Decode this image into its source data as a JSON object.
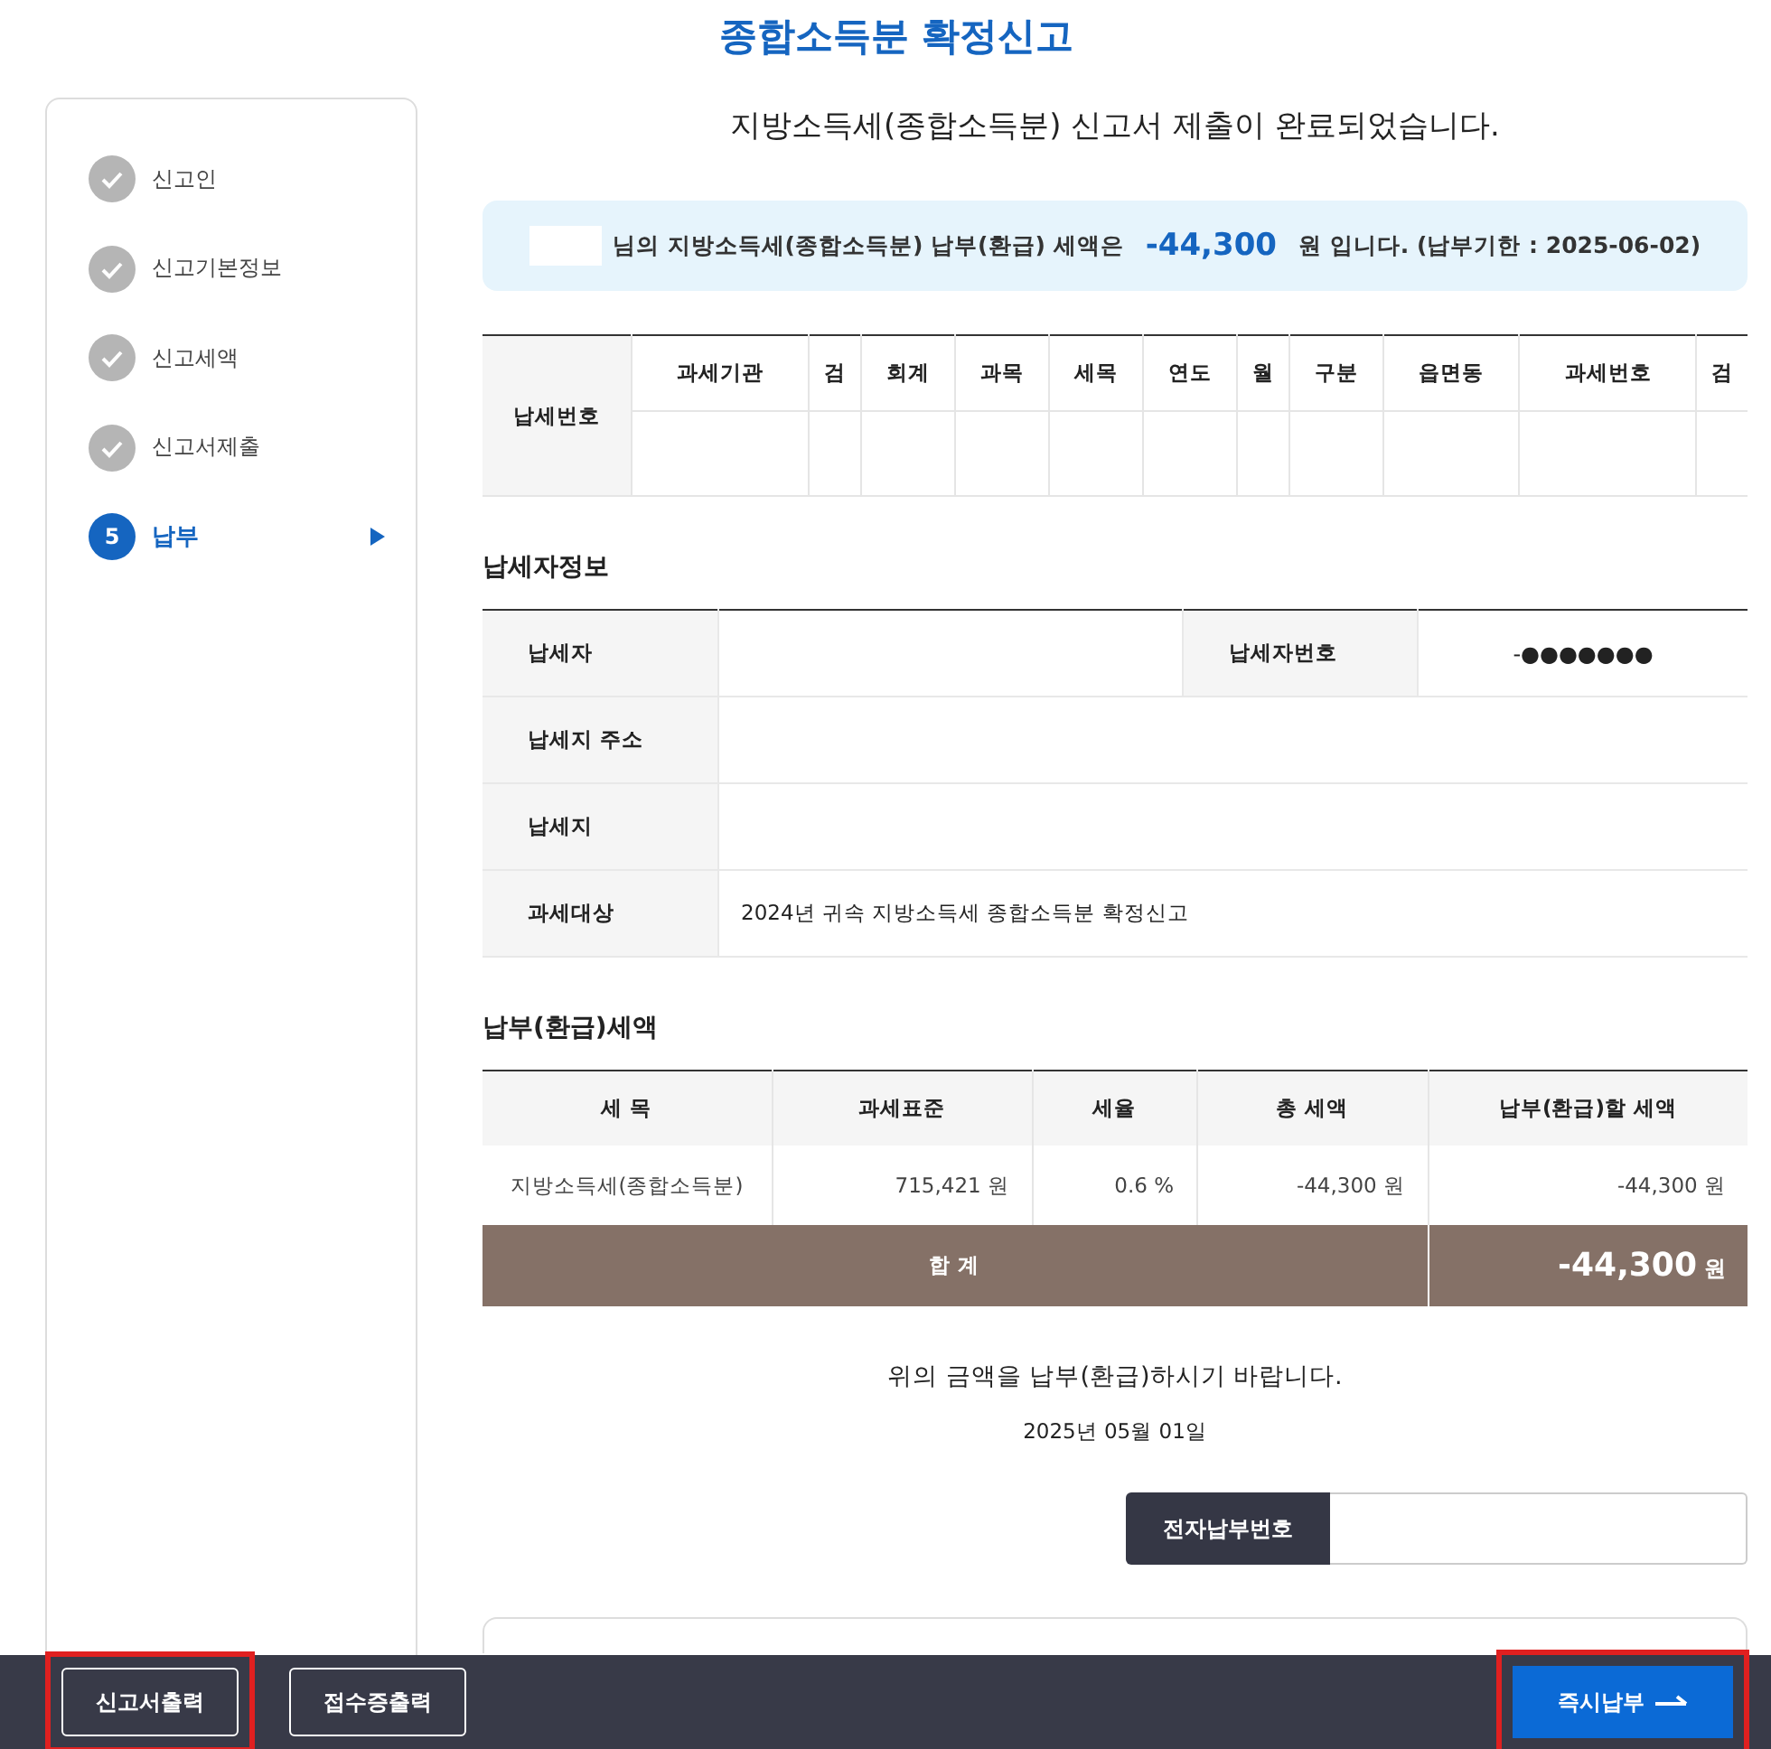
{
  "page_title": "종합소득분 확정신고",
  "steps": [
    {
      "label": "신고인",
      "completed": true,
      "selected": false
    },
    {
      "label": "신고기본정보",
      "completed": true,
      "selected": false
    },
    {
      "label": "신고세액",
      "completed": true,
      "selected": false
    },
    {
      "label": "신고서제출",
      "completed": true,
      "selected": false
    },
    {
      "label": "납부",
      "completed": false,
      "selected": true,
      "number": "5"
    }
  ],
  "completion_message": "지방소득세(종합소득분) 신고서 제출이 완료되었습니다.",
  "banner": {
    "prefix": "님의 지방소득세(종합소득분) 납부(환급) 세액은",
    "amount": "-44,300",
    "suffix": "원 입니다. (납부기한 : 2025-06-02)"
  },
  "payment_number_table": {
    "row_header": "납세번호",
    "columns": [
      "과세기관",
      "검",
      "회계",
      "과목",
      "세목",
      "연도",
      "월",
      "구분",
      "읍면동",
      "과세번호",
      "검"
    ]
  },
  "taxpayer_section": {
    "title": "납세자정보",
    "rows": [
      {
        "label": "납세자",
        "label_2": "납세자번호",
        "value_2": "-●●●●●●●"
      },
      {
        "label": "납세지 주소"
      },
      {
        "label": "납세지"
      },
      {
        "label": "과세대상",
        "value": "2024년 귀속 지방소득세 종합소득분 확정신고"
      }
    ]
  },
  "tax_section": {
    "title": "납부(환급)세액",
    "columns": [
      "세 목",
      "과세표준",
      "세율",
      "총 세액",
      "납부(환급)할 세액"
    ],
    "rows": [
      [
        "지방소득세(종합소득분)",
        "715,421 원",
        "0.6 %",
        "-44,300 원",
        "-44,300 원"
      ]
    ],
    "total_label": "합 계",
    "total_amount": "-44,300",
    "total_unit": "원"
  },
  "notice": "위의 금액을 납부(환급)하시기 바랍니다.",
  "date": "2025년 05월 01일",
  "epay_field": {
    "label": "전자납부번호"
  },
  "bottom_bar": {
    "left_buttons": [
      {
        "label": "신고서출력",
        "highlighted": true
      },
      {
        "label": "접수증출력",
        "highlighted": false
      }
    ],
    "right_button": {
      "label": "즉시납부",
      "highlighted": true
    }
  }
}
